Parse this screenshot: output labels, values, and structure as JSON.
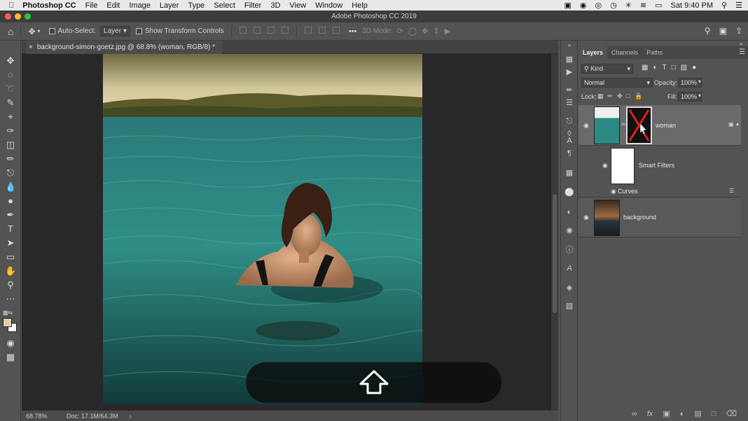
{
  "menubar": {
    "app": "Photoshop CC",
    "items": [
      "File",
      "Edit",
      "Image",
      "Layer",
      "Type",
      "Select",
      "Filter",
      "3D",
      "View",
      "Window",
      "Help"
    ],
    "clock": "Sat 9:40 PM"
  },
  "window_title": "Adobe Photoshop CC 2019",
  "options": {
    "auto_select_label": "Auto-Select:",
    "auto_select_value": "Layer",
    "transform_label": "Show Transform Controls",
    "mode_3d": "3D Mode:",
    "more": "•••"
  },
  "document": {
    "tab_title": "background-simon-goetz.jpg @ 68.8% (woman, RGB/8) *",
    "close": "×",
    "zoom": "68.78%",
    "doc_size": "Doc: 17.1M/64.3M",
    "status_arrow": "›"
  },
  "layers_panel": {
    "tabs": [
      "Layers",
      "Channels",
      "Paths"
    ],
    "filter_kind": "Kind",
    "blend_mode": "Normal",
    "opacity_label": "Opacity:",
    "opacity_value": "100%",
    "lock_label": "Lock:",
    "fill_label": "Fill:",
    "fill_value": "100%",
    "layers": [
      {
        "name": "woman",
        "visible": true,
        "selected": true
      },
      {
        "name": "Smart Filters",
        "visible": true
      },
      {
        "name": "Curves",
        "visible": true
      },
      {
        "name": "background",
        "visible": true
      }
    ]
  },
  "colors": {
    "ui_bg": "#535353",
    "canvas_bg": "#282828",
    "selected_layer": "#6a6a6a",
    "foreground_swatch": "#e4cfa2",
    "background_swatch": "#ffffff"
  }
}
